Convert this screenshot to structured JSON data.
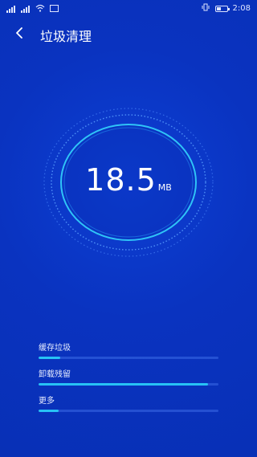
{
  "status_bar": {
    "time": "2:08"
  },
  "header": {
    "back_icon": "chevron-left-icon",
    "title": "垃圾清理"
  },
  "gauge": {
    "value": "18.5",
    "unit": "MB"
  },
  "items": [
    {
      "label": "缓存垃圾",
      "progress": 0.12
    },
    {
      "label": "卸载残留",
      "progress": 0.94
    },
    {
      "label": "更多",
      "progress": 0.11
    }
  ],
  "colors": {
    "background": "#0b35c4",
    "accent": "#27c2f5",
    "track": "#5a8cff"
  }
}
